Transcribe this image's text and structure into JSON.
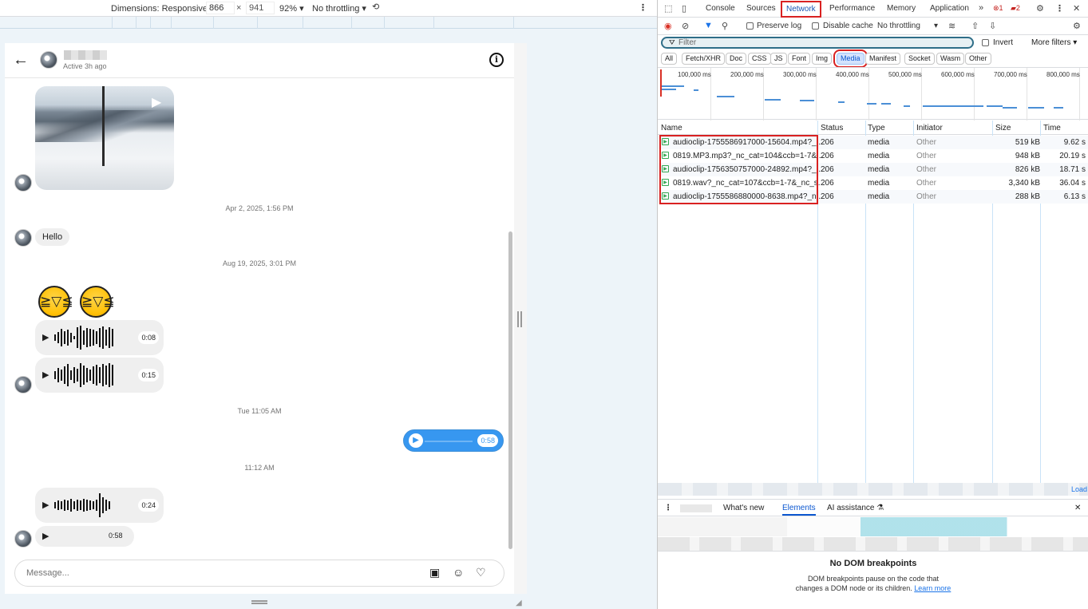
{
  "device_toolbar": {
    "dimensions_label": "Dimensions: Responsive ▾",
    "width": "866",
    "x": "×",
    "height": "941",
    "zoom": "92% ▾",
    "throttling": "No throttling ▾"
  },
  "chat": {
    "status": "Active 3h ago",
    "timestamps": [
      "Apr 2, 2025, 1:56 PM",
      "Aug 19, 2025, 3:01 PM",
      "Tue 11:05 AM",
      "11:12 AM"
    ],
    "text_message": "Hello",
    "audio_durations": [
      "0:08",
      "0:15",
      "0:58",
      "0:24",
      "0:58"
    ],
    "composer_placeholder": "Message..."
  },
  "devtools": {
    "tabs": [
      "Console",
      "Sources",
      "Network",
      "Performance",
      "Memory",
      "Application"
    ],
    "more_tabs": "»",
    "errors_count": "1",
    "issues_count": "2",
    "toolbar": {
      "preserve_log": "Preserve log",
      "disable_cache": "Disable cache",
      "throttling": "No throttling"
    },
    "filter": {
      "placeholder": "Filter",
      "invert": "Invert",
      "more_filters": "More filters ▾"
    },
    "type_chips": [
      "All",
      "Fetch/XHR",
      "Doc",
      "CSS",
      "JS",
      "Font",
      "Img",
      "Media",
      "Manifest",
      "Socket",
      "Wasm",
      "Other"
    ],
    "active_chip": "Media",
    "overview_ticks": [
      "100,000 ms",
      "200,000 ms",
      "300,000 ms",
      "400,000 ms",
      "500,000 ms",
      "600,000 ms",
      "700,000 ms",
      "800,000 ms"
    ],
    "columns": [
      "Name",
      "Status",
      "Type",
      "Initiator",
      "Size",
      "Time"
    ],
    "requests": [
      {
        "name": "audioclip-1755586917000-15604.mp4?_...",
        "status": "206",
        "type": "media",
        "initiator": "Other",
        "size": "519 kB",
        "time": "9.62 s"
      },
      {
        "name": "0819.MP3.mp3?_nc_cat=104&ccb=1-7&...",
        "status": "206",
        "type": "media",
        "initiator": "Other",
        "size": "948 kB",
        "time": "20.19 s"
      },
      {
        "name": "audioclip-1756350757000-24892.mp4?_...",
        "status": "206",
        "type": "media",
        "initiator": "Other",
        "size": "826 kB",
        "time": "18.71 s"
      },
      {
        "name": "0819.wav?_nc_cat=107&ccb=1-7&_nc_s...",
        "status": "206",
        "type": "media",
        "initiator": "Other",
        "size": "3,340 kB",
        "time": "36.04 s"
      },
      {
        "name": "audioclip-1755586880000-8638.mp4?_n...",
        "status": "206",
        "type": "media",
        "initiator": "Other",
        "size": "288 kB",
        "time": "6.13 s"
      }
    ],
    "load_label": "Load",
    "drawer_tabs": {
      "whats_new": "What's new",
      "elements": "Elements",
      "ai_assistance": "AI assistance ⚗"
    },
    "dom_breakpoints": {
      "title": "No DOM breakpoints",
      "description": "DOM breakpoints pause on the code that changes a DOM node or its children.",
      "learn_more": "Learn more"
    }
  }
}
